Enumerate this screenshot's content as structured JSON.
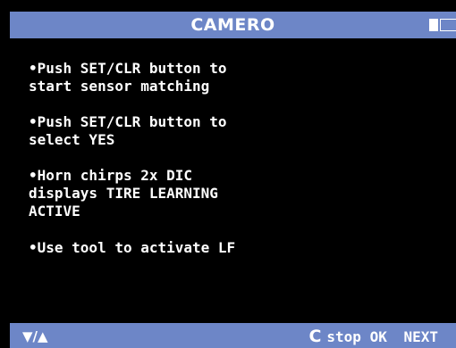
{
  "header": {
    "title": "CAMERO",
    "battery_icon": "battery-icon"
  },
  "instructions": [
    "•Push SET/CLR button to\nstart sensor matching",
    "•Push SET/CLR button to\nselect YES",
    "•Horn chirps 2x DIC\ndisplays TIRE LEARNING\nACTIVE",
    "•Use tool to activate LF"
  ],
  "footer": {
    "nav": "▼/▲",
    "c_key": "C",
    "stop": "stop",
    "ok": "OK",
    "next": "NEXT"
  },
  "colors": {
    "bar": "#6d86c7",
    "background": "#000000",
    "text": "#ffffff"
  }
}
